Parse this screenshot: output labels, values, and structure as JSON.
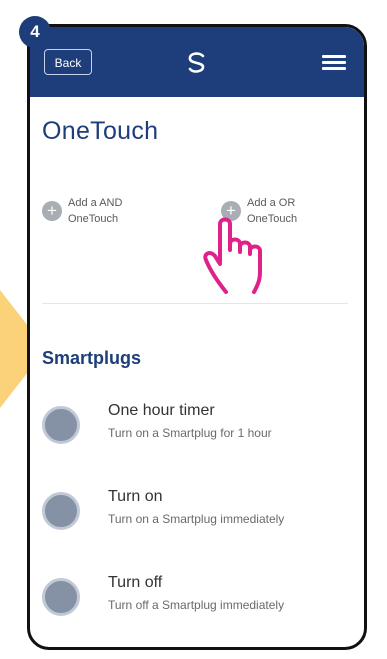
{
  "step": {
    "number": "4"
  },
  "header": {
    "back_label": "Back",
    "logo_icon": "swirl-logo-icon",
    "menu_icon": "hamburger-menu-icon"
  },
  "page": {
    "title": "OneTouch"
  },
  "add_buttons": [
    {
      "line1": "Add a AND",
      "line2": "OneTouch",
      "icon": "plus-circle-icon"
    },
    {
      "line1": "Add a OR",
      "line2": "OneTouch",
      "icon": "plus-circle-icon"
    }
  ],
  "section": {
    "title": "Smartplugs",
    "items": [
      {
        "title": "One hour timer",
        "subtitle": "Turn on a Smartplug for 1 hour"
      },
      {
        "title": "Turn on",
        "subtitle": "Turn on a Smartplug immediately"
      },
      {
        "title": "Turn off",
        "subtitle": "Turn off a Smartplug immediately"
      }
    ]
  },
  "colors": {
    "header": "#1d3e7a",
    "accent_pointer": "#fbd17a",
    "hand_outline": "#e0218a",
    "radio_fill": "#8591a4"
  }
}
